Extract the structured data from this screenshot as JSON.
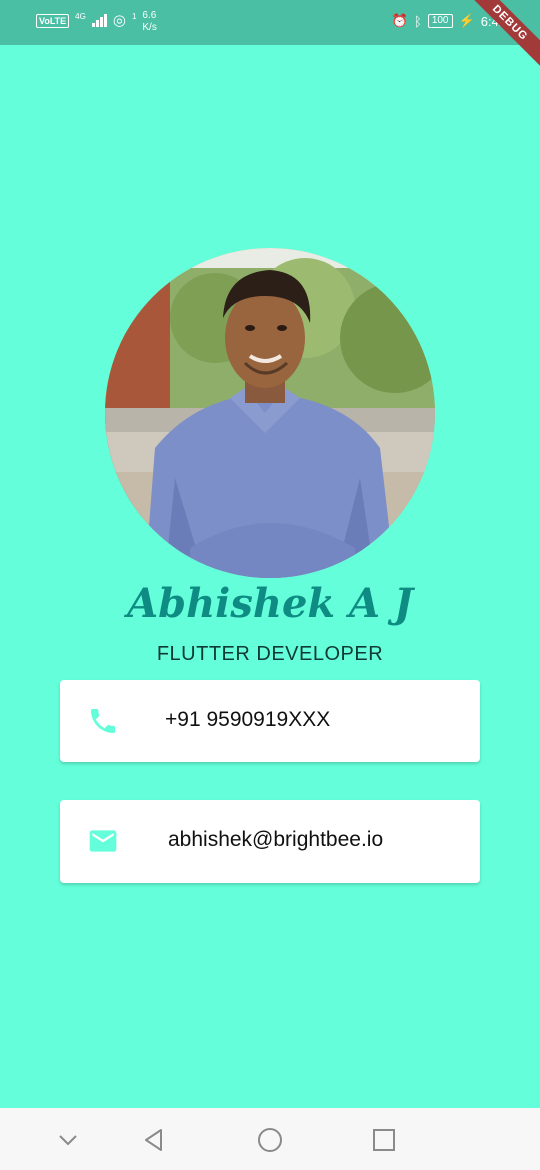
{
  "status_bar": {
    "volte": "VoLTE",
    "network_type": "4G",
    "hotspot_count": "1",
    "speed_value": "6.6",
    "speed_unit": "K/s",
    "battery": "100",
    "time": "6:42",
    "debug_label": "DEBUG"
  },
  "profile": {
    "name": "Abhishek A J",
    "title": "FLUTTER DEVELOPER"
  },
  "contacts": {
    "phone": {
      "icon": "phone-icon",
      "value": "+91 9590919XXX"
    },
    "email": {
      "icon": "mail-icon",
      "value": "abhishek@brightbee.io"
    }
  },
  "colors": {
    "background": "#64FFDA",
    "status_bar": "#4BBFA4",
    "name_text": "#0E8C83",
    "icon_color": "#64FFDA"
  },
  "nav_bar": {
    "icons": [
      "chevron-down-icon",
      "back-icon",
      "home-icon",
      "recents-icon"
    ]
  }
}
